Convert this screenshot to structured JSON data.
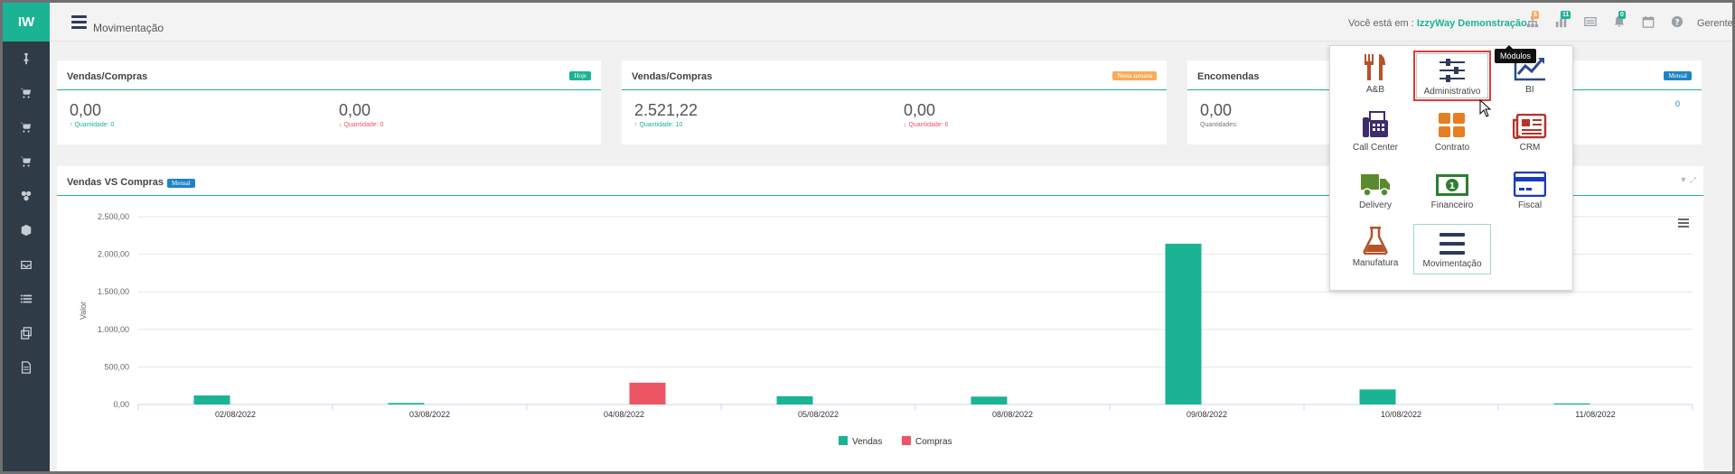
{
  "app": {
    "logo": "IW",
    "page_title": "Movimentação",
    "location_prefix": "Você está em :",
    "location_name": "IzzyWay Demonstração",
    "user": "Gerente",
    "tooltip": "Módulos",
    "badges": {
      "alerts": "5",
      "modules": "11",
      "notifications": "0"
    },
    "colors": {
      "accent": "#1ab394",
      "sidebar": "#2f3b47",
      "red": "#ed5565",
      "orange": "#f8ac59",
      "blue": "#1c84c6"
    }
  },
  "sidebar_icons": [
    "pin-icon",
    "cart-icon",
    "cart-icon",
    "cart-icon",
    "boxes-icon",
    "box-icon",
    "inbox-icon",
    "list-icon",
    "copy-icon",
    "document-icon"
  ],
  "cards": [
    {
      "title": "Vendas/Compras",
      "tag": "Hoje",
      "tag_color": "#1ab394",
      "left_value": "0,00",
      "left_sub": "Quantidade: 0",
      "right_value": "0,00",
      "right_sub": "Quantidade: 0"
    },
    {
      "title": "Vendas/Compras",
      "tag": "Nesta semana",
      "tag_color": "#f8ac59",
      "left_value": "2.521,22",
      "left_sub": "Quantidade: 10",
      "right_value": "0,00",
      "right_sub": "Quantidade: 6"
    },
    {
      "title": "Encomendas",
      "tag": "Mensal",
      "tag_color": "#1c84c6",
      "left_value": "0,00",
      "left_sub": "Quantidades:",
      "right_value": "",
      "right_sub": "0"
    }
  ],
  "chart_panel": {
    "title": "Vendas VS Compras",
    "tag": "Mensal"
  },
  "modules": [
    {
      "label": "A&B",
      "icon": "utensils-icon"
    },
    {
      "label": "Administrativo",
      "icon": "sliders-icon",
      "state": "hover"
    },
    {
      "label": "BI",
      "icon": "line-chart-icon"
    },
    {
      "label": "Call Center",
      "icon": "fax-icon"
    },
    {
      "label": "Contrato",
      "icon": "grid-icon"
    },
    {
      "label": "CRM",
      "icon": "newspaper-icon"
    },
    {
      "label": "Delivery",
      "icon": "truck-icon"
    },
    {
      "label": "Financeiro",
      "icon": "money-icon"
    },
    {
      "label": "Fiscal",
      "icon": "credit-card-icon"
    },
    {
      "label": "Manufatura",
      "icon": "flask-icon"
    },
    {
      "label": "Movimentação",
      "icon": "bars-icon",
      "state": "selected"
    }
  ],
  "chart_data": {
    "type": "bar",
    "categories": [
      "02/08/2022",
      "03/08/2022",
      "04/08/2022",
      "05/08/2022",
      "08/08/2022",
      "09/08/2022",
      "10/08/2022",
      "11/08/2022"
    ],
    "series": [
      {
        "name": "Vendas",
        "color": "#1ab394",
        "values": [
          120,
          20,
          0,
          110,
          105,
          2140,
          200,
          15
        ]
      },
      {
        "name": "Compras",
        "color": "#ed5565",
        "values": [
          0,
          0,
          290,
          0,
          0,
          0,
          0,
          0
        ]
      }
    ],
    "ylabel": "Valor",
    "yticks": [
      "0,00",
      "500,00",
      "1.000,00",
      "1.500,00",
      "2.000,00",
      "2.500,00"
    ],
    "ylim": [
      0,
      2500
    ],
    "grid": true,
    "legend": "bottom-center"
  }
}
